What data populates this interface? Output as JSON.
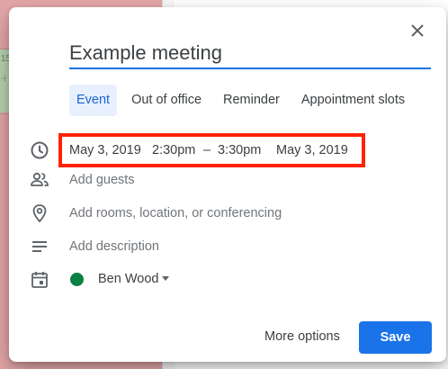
{
  "background": {
    "event_snippets": [
      "15",
      "-i"
    ]
  },
  "dialog": {
    "title": "Example meeting",
    "close_icon": "close-icon",
    "tabs": [
      {
        "label": "Event",
        "active": true
      },
      {
        "label": "Out of office",
        "active": false
      },
      {
        "label": "Reminder",
        "active": false
      },
      {
        "label": "Appointment slots",
        "active": false
      }
    ],
    "datetime": {
      "icon": "clock-icon",
      "start_date": "May 3, 2019",
      "start_time": "2:30pm",
      "separator": "–",
      "end_time": "3:30pm",
      "end_date": "May 3, 2019",
      "highlight_color": "#ff2200"
    },
    "guests": {
      "icon": "people-icon",
      "placeholder": "Add guests"
    },
    "location": {
      "icon": "location-pin-icon",
      "placeholder": "Add rooms, location, or conferencing"
    },
    "description": {
      "icon": "description-lines-icon",
      "placeholder": "Add description"
    },
    "calendar": {
      "icon": "calendar-icon",
      "name": "Ben Wood",
      "color": "#0b8043"
    },
    "more_options_label": "More options",
    "save_label": "Save"
  },
  "colors": {
    "accent": "#1a73e8",
    "tab_active_bg": "#e8f0fe"
  }
}
